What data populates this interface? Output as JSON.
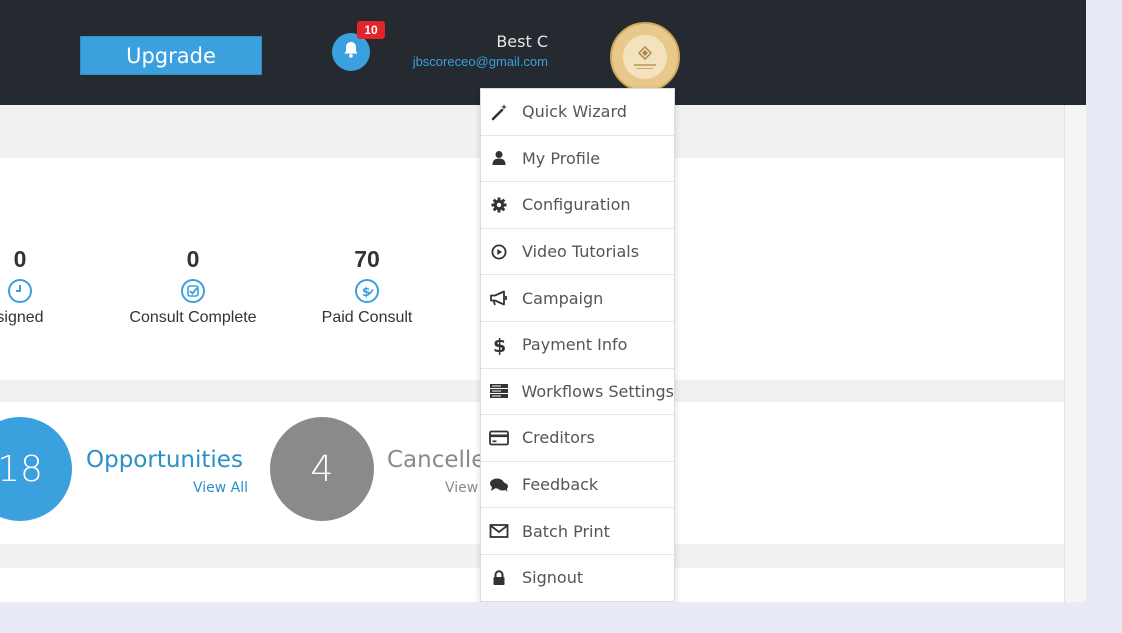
{
  "header": {
    "upgrade_label": "Upgrade",
    "notification_count": "10",
    "user_name": "Best C",
    "user_email": "jbscoreceo@gmail.com"
  },
  "stats": [
    {
      "value": "0",
      "label": "signed",
      "icon": "clock-icon"
    },
    {
      "value": "0",
      "label": "Consult Complete",
      "icon": "check-badge-icon"
    },
    {
      "value": "70",
      "label": "Paid Consult",
      "icon": "dollar-check-icon"
    }
  ],
  "opportunities": {
    "count": "18",
    "title": "Opportunities",
    "link": "View All"
  },
  "cancelled": {
    "count": "4",
    "title": "Cancelle",
    "link": "View"
  },
  "user_menu": [
    {
      "label": "Quick Wizard",
      "icon": "magic-wand-icon"
    },
    {
      "label": "My Profile",
      "icon": "user-icon"
    },
    {
      "label": "Configuration",
      "icon": "gear-icon"
    },
    {
      "label": "Video Tutorials",
      "icon": "play-circle-icon"
    },
    {
      "label": "Campaign",
      "icon": "megaphone-icon"
    },
    {
      "label": "Payment Info",
      "icon": "dollar-icon"
    },
    {
      "label": "Workflows Settings",
      "icon": "server-icon"
    },
    {
      "label": "Creditors",
      "icon": "credit-card-icon"
    },
    {
      "label": "Feedback",
      "icon": "comments-icon"
    },
    {
      "label": "Batch Print",
      "icon": "envelope-icon"
    },
    {
      "label": "Signout",
      "icon": "lock-icon"
    }
  ],
  "colors": {
    "topbar": "#252a30",
    "accent": "#3aa0de",
    "badge": "#e3242b",
    "cancelled_circle": "#8a8a8a"
  }
}
